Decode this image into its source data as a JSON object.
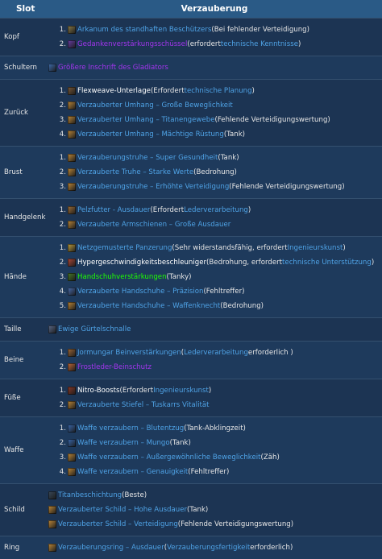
{
  "header": {
    "slot": "Slot",
    "enchant": "Verzauberung"
  },
  "rows": [
    {
      "slot": "Kopf",
      "numbered": true,
      "lines": [
        {
          "num": "1.",
          "icon": "rune-icon",
          "color": "#8a7b4a",
          "parts": [
            {
              "t": "Arkanum des standhaften Beschützers",
              "c": "c-blue"
            },
            {
              "t": " (Bei fehlender Verteidigung)",
              "c": "tn"
            }
          ]
        },
        {
          "num": "2.",
          "icon": "bowl-icon",
          "color": "#6a3fa8",
          "parts": [
            {
              "t": "Gedankenverstärkungsschüssel",
              "c": "c-purple"
            },
            {
              "t": " (erfordert ",
              "c": "tn"
            },
            {
              "t": "technische Kenntnisse",
              "c": "c-blue"
            },
            {
              "t": " )",
              "c": "tn"
            }
          ]
        }
      ]
    },
    {
      "slot": "Schultern",
      "numbered": false,
      "lines": [
        {
          "icon": "shoulder-inscription-icon",
          "color": "#3f6fb0",
          "parts": [
            {
              "t": "Größere Inschrift des Gladiators",
              "c": "c-purple"
            }
          ]
        }
      ]
    },
    {
      "slot": "Zurück",
      "numbered": true,
      "lines": [
        {
          "num": "1.",
          "icon": "flexweave-icon",
          "color": "#7a5a3a",
          "parts": [
            {
              "t": "Flexweave-Unterlage",
              "c": "c-white"
            },
            {
              "t": " (Erfordert ",
              "c": "tn"
            },
            {
              "t": "technische Planung",
              "c": "c-blue"
            },
            {
              "t": " )",
              "c": "tn"
            }
          ]
        },
        {
          "num": "2.",
          "icon": "scroll-icon",
          "color": "#c08a3a",
          "parts": [
            {
              "t": "Verzauberter Umhang – Große Beweglichkeit",
              "c": "c-blue"
            }
          ]
        },
        {
          "num": "3.",
          "icon": "scroll-icon",
          "color": "#c08a3a",
          "parts": [
            {
              "t": "Verzauberter Umhang – Titanengewebe",
              "c": "c-blue"
            },
            {
              "t": " (Fehlende Verteidigungswertung)",
              "c": "tn"
            }
          ]
        },
        {
          "num": "4.",
          "icon": "scroll-icon",
          "color": "#c08a3a",
          "parts": [
            {
              "t": "Verzauberter Umhang – Mächtige Rüstung",
              "c": "c-blue"
            },
            {
              "t": " (Tank)",
              "c": "tn"
            }
          ]
        }
      ]
    },
    {
      "slot": "Brust",
      "numbered": true,
      "lines": [
        {
          "num": "1.",
          "icon": "scroll-icon",
          "color": "#c08a3a",
          "parts": [
            {
              "t": "Verzauberungstruhe – Super Gesundheit",
              "c": "c-blue"
            },
            {
              "t": " (Tank)",
              "c": "tn"
            }
          ]
        },
        {
          "num": "2.",
          "icon": "scroll-icon",
          "color": "#c08a3a",
          "parts": [
            {
              "t": "Verzauberte Truhe – Starke Werte",
              "c": "c-blue"
            },
            {
              "t": " (Bedrohung)",
              "c": "tn"
            }
          ]
        },
        {
          "num": "3.",
          "icon": "scroll-icon",
          "color": "#c08a3a",
          "parts": [
            {
              "t": "Verzauberungstruhe – Erhöhte Verteidigung",
              "c": "c-blue"
            },
            {
              "t": " (Fehlende Verteidigungswertung)",
              "c": "tn"
            }
          ]
        }
      ]
    },
    {
      "slot": "Handgelenk",
      "numbered": true,
      "lines": [
        {
          "num": "1.",
          "icon": "fur-lining-icon",
          "color": "#a0703a",
          "parts": [
            {
              "t": "Pelzfutter - Ausdauer",
              "c": "c-blue"
            },
            {
              "t": " (Erfordert ",
              "c": "tn"
            },
            {
              "t": "Lederverarbeitung",
              "c": "c-blue"
            },
            {
              "t": " )",
              "c": "tn"
            }
          ]
        },
        {
          "num": "2.",
          "icon": "scroll-icon",
          "color": "#c08a3a",
          "parts": [
            {
              "t": "Verzauberte Armschienen – Große Ausdauer",
              "c": "c-blue"
            }
          ]
        }
      ]
    },
    {
      "slot": "Hände",
      "numbered": true,
      "lines": [
        {
          "num": "1.",
          "icon": "netting-icon",
          "color": "#c0a040",
          "parts": [
            {
              "t": "Netzgemusterte Panzerung",
              "c": "c-blue"
            },
            {
              "t": " (Sehr widerstandsfähig, erfordert ",
              "c": "tn"
            },
            {
              "t": "Ingenieurskunst",
              "c": "c-blue"
            },
            {
              "t": " )",
              "c": "tn"
            }
          ]
        },
        {
          "num": "2.",
          "icon": "accelerator-icon",
          "color": "#b04a3a",
          "parts": [
            {
              "t": "Hypergeschwindigkeitsbeschleuniger",
              "c": "c-white"
            },
            {
              "t": " (Bedrohung, erfordert ",
              "c": "tn"
            },
            {
              "t": "technische Unterstützung",
              "c": "c-blue"
            },
            {
              "t": " )",
              "c": "tn"
            }
          ]
        },
        {
          "num": "3.",
          "icon": "glove-reinforcement-icon",
          "color": "#4a7a2a",
          "parts": [
            {
              "t": "Handschuhverstärkungen",
              "c": "c-green"
            },
            {
              "t": " (Tanky)",
              "c": "tn"
            }
          ]
        },
        {
          "num": "4.",
          "icon": "scroll-icon",
          "color": "#4a6fb0",
          "parts": [
            {
              "t": "Verzauberte Handschuhe – Präzision",
              "c": "c-blue"
            },
            {
              "t": " (Fehltreffer)",
              "c": "tn"
            }
          ]
        },
        {
          "num": "5.",
          "icon": "scroll-icon",
          "color": "#c08a3a",
          "parts": [
            {
              "t": "Verzauberte Handschuhe – Waffenknecht",
              "c": "c-blue"
            },
            {
              "t": " (Bedrohung)",
              "c": "tn"
            }
          ]
        }
      ]
    },
    {
      "slot": "Taille",
      "numbered": false,
      "lines": [
        {
          "icon": "buckle-icon",
          "color": "#5a6a8a",
          "parts": [
            {
              "t": "Ewige Gürtelschnalle",
              "c": "c-blue"
            }
          ]
        }
      ]
    },
    {
      "slot": "Beine",
      "numbered": true,
      "lines": [
        {
          "num": "1.",
          "icon": "armor-kit-icon",
          "color": "#a06a3a",
          "parts": [
            {
              "t": "Jormungar Beinverstärkungen",
              "c": "c-blue"
            },
            {
              "t": " ( ",
              "c": "tn"
            },
            {
              "t": "Lederverarbeitung",
              "c": "c-blue"
            },
            {
              "t": " erforderlich )",
              "c": "tn"
            }
          ]
        },
        {
          "num": "2.",
          "icon": "spellthread-icon",
          "color": "#c06a3a",
          "parts": [
            {
              "t": "Frostleder-Beinschutz",
              "c": "c-purple"
            }
          ]
        }
      ]
    },
    {
      "slot": "Füße",
      "numbered": true,
      "lines": [
        {
          "num": "1.",
          "icon": "nitro-boots-icon",
          "color": "#8a3a2a",
          "parts": [
            {
              "t": "Nitro-Boosts",
              "c": "c-white"
            },
            {
              "t": " (Erfordert ",
              "c": "tn"
            },
            {
              "t": "Ingenieurskunst",
              "c": "c-blue"
            },
            {
              "t": " )",
              "c": "tn"
            }
          ]
        },
        {
          "num": "2.",
          "icon": "scroll-icon",
          "color": "#c08a3a",
          "parts": [
            {
              "t": "Verzauberte Stiefel – Tuskarrs Vitalität",
              "c": "c-blue"
            }
          ]
        }
      ]
    },
    {
      "slot": "Waffe",
      "numbered": true,
      "lines": [
        {
          "num": "1.",
          "icon": "scroll-icon",
          "color": "#3a6ab0",
          "parts": [
            {
              "t": "Waffe verzaubern – Blutentzug",
              "c": "c-blue"
            },
            {
              "t": " (Tank-Abklingzeit)",
              "c": "tn"
            }
          ]
        },
        {
          "num": "2.",
          "icon": "scroll-icon",
          "color": "#3a6ab0",
          "parts": [
            {
              "t": "Waffe verzaubern – Mungo",
              "c": "c-blue"
            },
            {
              "t": " (Tank)",
              "c": "tn"
            }
          ]
        },
        {
          "num": "3.",
          "icon": "scroll-icon",
          "color": "#c08a3a",
          "parts": [
            {
              "t": "Waffe verzaubern – Außergewöhnliche Beweglichkeit",
              "c": "c-blue"
            },
            {
              "t": " (Zäh)",
              "c": "tn"
            }
          ]
        },
        {
          "num": "4.",
          "icon": "scroll-icon",
          "color": "#c08a3a",
          "parts": [
            {
              "t": "Waffe verzaubern – Genauigkeit",
              "c": "c-blue"
            },
            {
              "t": " (Fehltreffer)",
              "c": "tn"
            }
          ]
        }
      ]
    },
    {
      "slot": "Schild",
      "numbered": false,
      "lines": [
        {
          "icon": "shield-plating-icon",
          "color": "#3a4a5a",
          "parts": [
            {
              "t": "Titanbeschichtung",
              "c": "c-blue"
            },
            {
              "t": " (Beste)",
              "c": "tn"
            }
          ]
        },
        {
          "icon": "scroll-icon",
          "color": "#c08a3a",
          "parts": [
            {
              "t": "Verzauberter Schild – Hohe Ausdauer",
              "c": "c-blue"
            },
            {
              "t": " (Tank)",
              "c": "tn"
            }
          ]
        },
        {
          "icon": "scroll-icon",
          "color": "#c08a3a",
          "parts": [
            {
              "t": "Verzauberter Schild – Verteidigung",
              "c": "c-blue"
            },
            {
              "t": " (Fehlende Verteidigungswertung)",
              "c": "tn"
            }
          ]
        }
      ]
    },
    {
      "slot": "Ring",
      "numbered": false,
      "lines": [
        {
          "icon": "scroll-icon",
          "color": "#c08a3a",
          "parts": [
            {
              "t": "Verzauberungsring – Ausdauer",
              "c": "c-blue"
            },
            {
              "t": " ( ",
              "c": "tn"
            },
            {
              "t": "Verzauberungsfertigkeit",
              "c": "c-blue"
            },
            {
              "t": " erforderlich)",
              "c": "tn"
            }
          ]
        }
      ]
    }
  ]
}
